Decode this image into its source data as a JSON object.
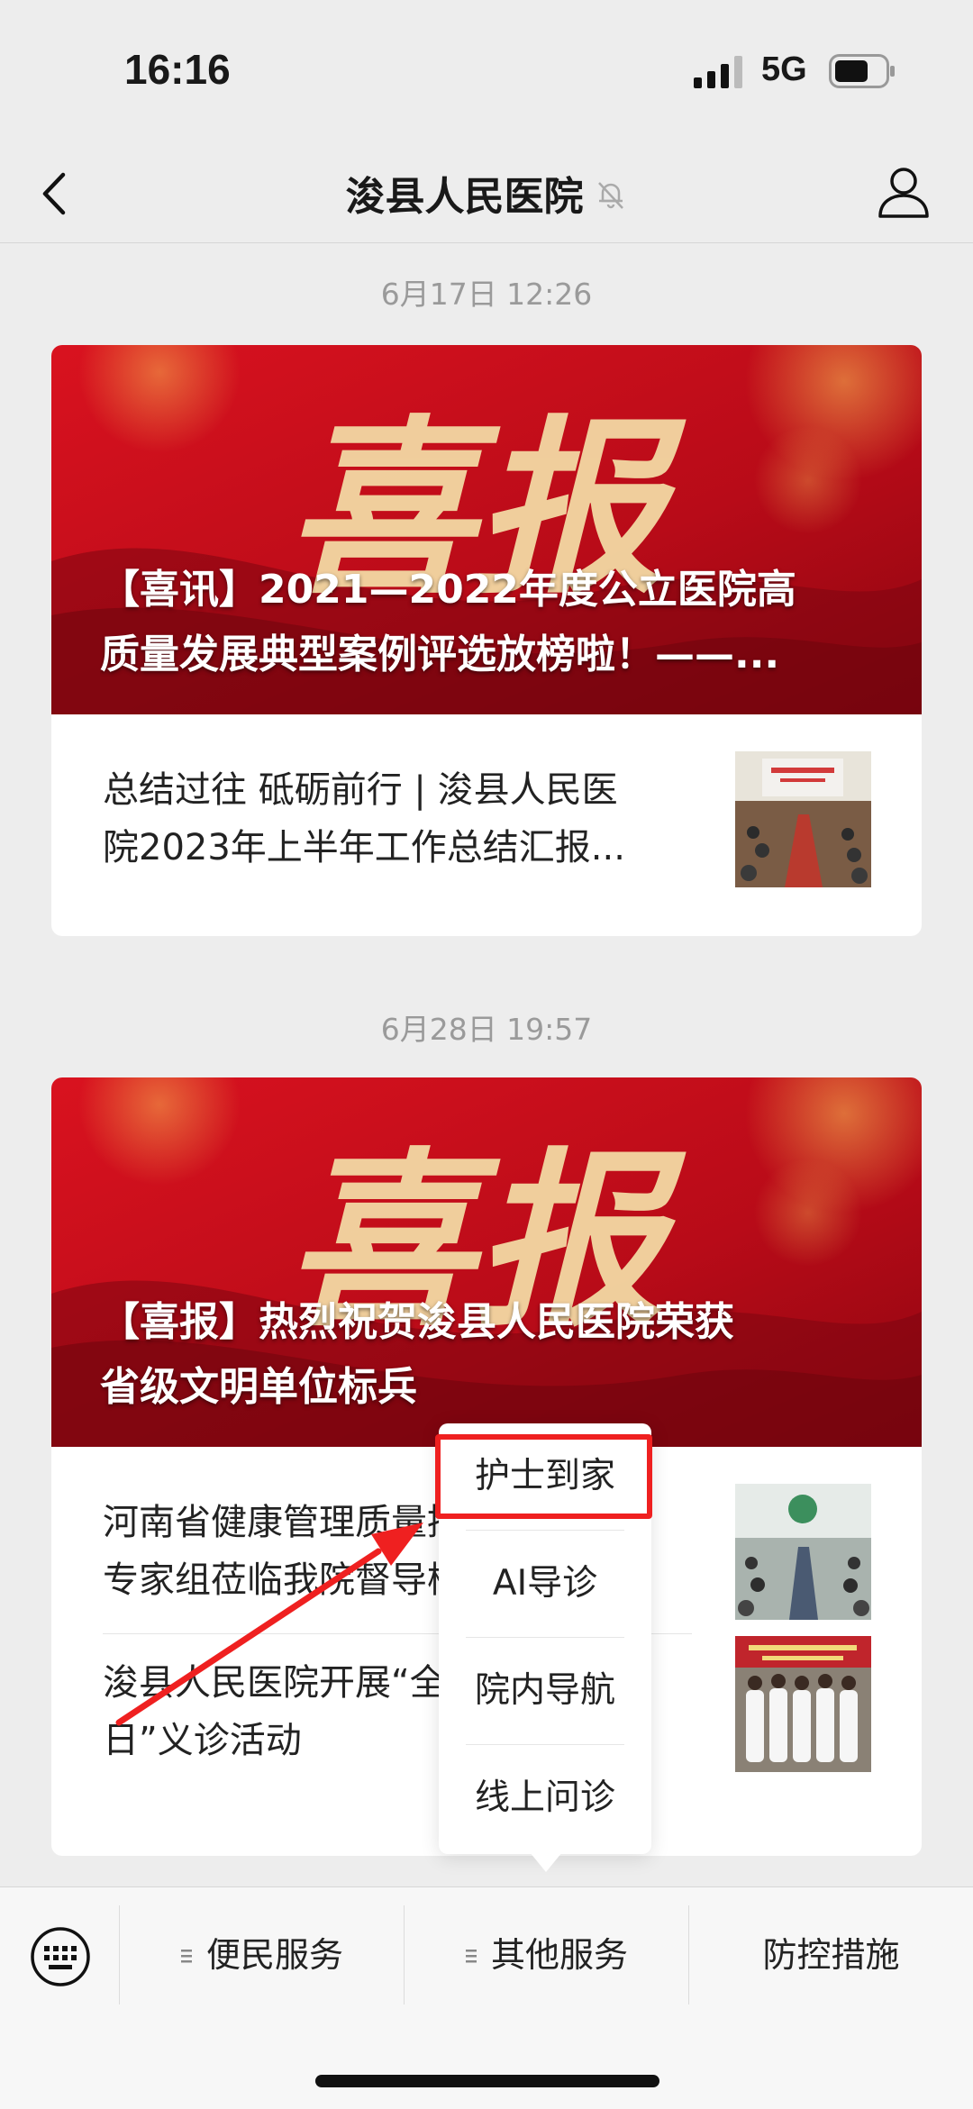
{
  "status_bar": {
    "time": "16:16",
    "network": "5G"
  },
  "nav": {
    "title": "浚县人民医院"
  },
  "messages": [
    {
      "timestamp": "6月17日 12:26",
      "banner": {
        "image_text": "喜报",
        "title_lines": [
          "【喜讯】2021—2022年度公立医院高",
          "质量发展典型案例评选放榜啦！——..."
        ]
      },
      "articles": [
        {
          "lines": [
            "总结过往 砥砺前行 | 浚县人民医",
            "院2023年上半年工作总结汇报..."
          ]
        }
      ]
    },
    {
      "timestamp": "6月28日 19:57",
      "banner": {
        "image_text": "喜报",
        "title_lines": [
          "【喜报】热烈祝贺浚县人民医院荣获",
          "省级文明单位标兵"
        ]
      },
      "articles": [
        {
          "lines": [
            "河南省健康管理质量控制中心",
            "专家组莅临我院督导检查工作..."
          ]
        },
        {
          "lines": [
            "浚县人民医院开展“全国爱眼爱",
            "日”义诊活动"
          ]
        }
      ]
    }
  ],
  "popup_menu": {
    "items": [
      "护士到家",
      "AI导诊",
      "院内导航",
      "线上问诊"
    ]
  },
  "bottom_menu": {
    "tabs": [
      "便民服务",
      "其他服务",
      "防控措施"
    ]
  },
  "colors": {
    "highlight": "#ef2020",
    "banner_red": "#c8101b"
  }
}
